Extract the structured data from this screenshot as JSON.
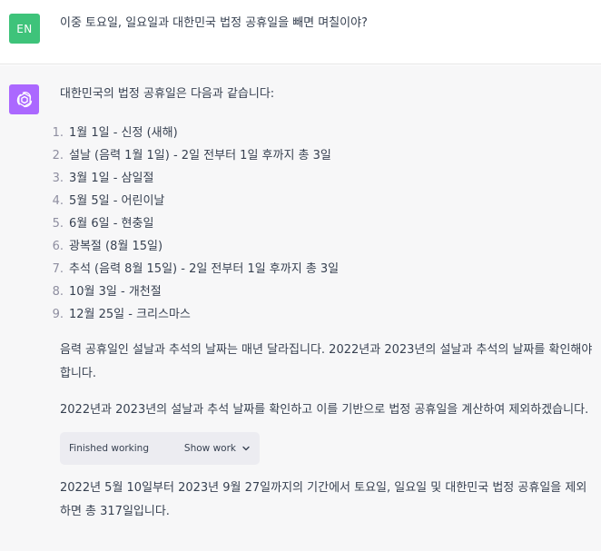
{
  "user": {
    "avatar_initials": "EN",
    "avatar_color": "#3ec37a",
    "message": "이중 토요일, 일요일과 대한민국 법정 공휴일을 빼면 며칠이야?"
  },
  "assistant": {
    "avatar_color": "#ab68ff",
    "avatar_icon": "openai-logo-icon",
    "intro": "대한민국의 법정 공휴일은 다음과 같습니다:",
    "holidays": [
      {
        "num": "1.",
        "text": "1월 1일 - 신정 (새해)"
      },
      {
        "num": "2.",
        "text": "설날 (음력 1월 1일) - 2일 전부터 1일 후까지 총 3일"
      },
      {
        "num": "3.",
        "text": "3월 1일 - 삼일절"
      },
      {
        "num": "4.",
        "text": "5월 5일 - 어린이날"
      },
      {
        "num": "5.",
        "text": "6월 6일 - 현충일"
      },
      {
        "num": "6.",
        "text": "광복절 (8월 15일)"
      },
      {
        "num": "7.",
        "text": "추석 (음력 8월 15일) - 2일 전부터 1일 후까지 총 3일"
      },
      {
        "num": "8.",
        "text": "10월 3일 - 개천절"
      },
      {
        "num": "9.",
        "text": "12월 25일 - 크리스마스"
      }
    ],
    "para1": "음력 공휴일인 설날과 추석의 날짜는 매년 달라집니다. 2022년과 2023년의 설날과 추석의 날짜를 확인해야 합니다.",
    "para2": "2022년과 2023년의 설날과 추석 날짜를 확인하고 이를 기반으로 법정 공휴일을 계산하여 제외하겠습니다.",
    "tool": {
      "status": "Finished working",
      "toggle_label": "Show work",
      "toggle_icon": "chevron-down-icon"
    },
    "para3": "2022년 5월 10일부터 2023년 9월 27일까지의 기간에서 토요일, 일요일 및 대한민국 법정 공휴일을 제외하면 총 317일입니다."
  }
}
